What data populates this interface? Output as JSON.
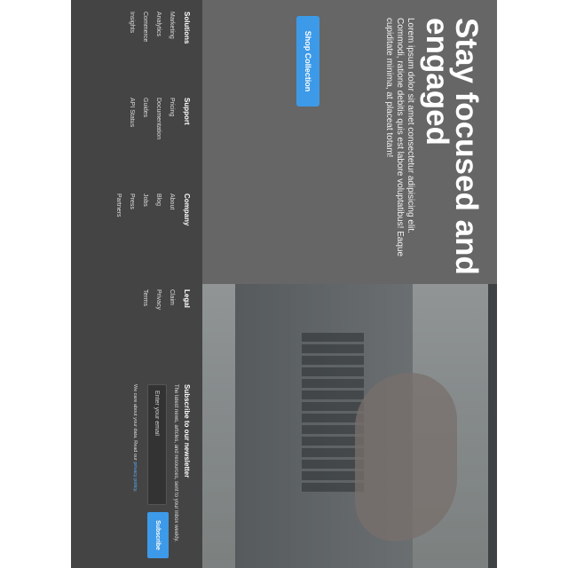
{
  "hero": {
    "title": "Stay focused and engaged",
    "text": "Lorem ipsum dolor sit amet consectetur adipisicing elit. Commodi, ratione debitis quis est labore voluptatibus! Eaque cupiditate minima, at placeat totam!",
    "button_label": "Shop Collection"
  },
  "footer": {
    "columns": [
      {
        "heading": "Solutions",
        "links": [
          "Marketing",
          "Analytics",
          "Commerce",
          "Insights"
        ]
      },
      {
        "heading": "Support",
        "links": [
          "Pricing",
          "Documentation",
          "Guides",
          "API Status"
        ]
      },
      {
        "heading": "Company",
        "links": [
          "About",
          "Blog",
          "Jobs",
          "Press",
          "Partners"
        ]
      },
      {
        "heading": "Legal",
        "links": [
          "Claim",
          "Privacy",
          "Terms"
        ]
      }
    ],
    "newsletter": {
      "heading": "Subscribe to our newsletter",
      "description": "The latest news, articles, and resources, sent to your inbox weekly.",
      "email_placeholder": "Enter your email",
      "button_label": "Subscribe",
      "note_prefix": "We care about your data. Read our ",
      "note_link": "privacy policy",
      "note_suffix": "."
    }
  },
  "colors": {
    "accent": "#3d9ae8",
    "hero_panel": "#666666",
    "footer_bg": "#444444"
  }
}
